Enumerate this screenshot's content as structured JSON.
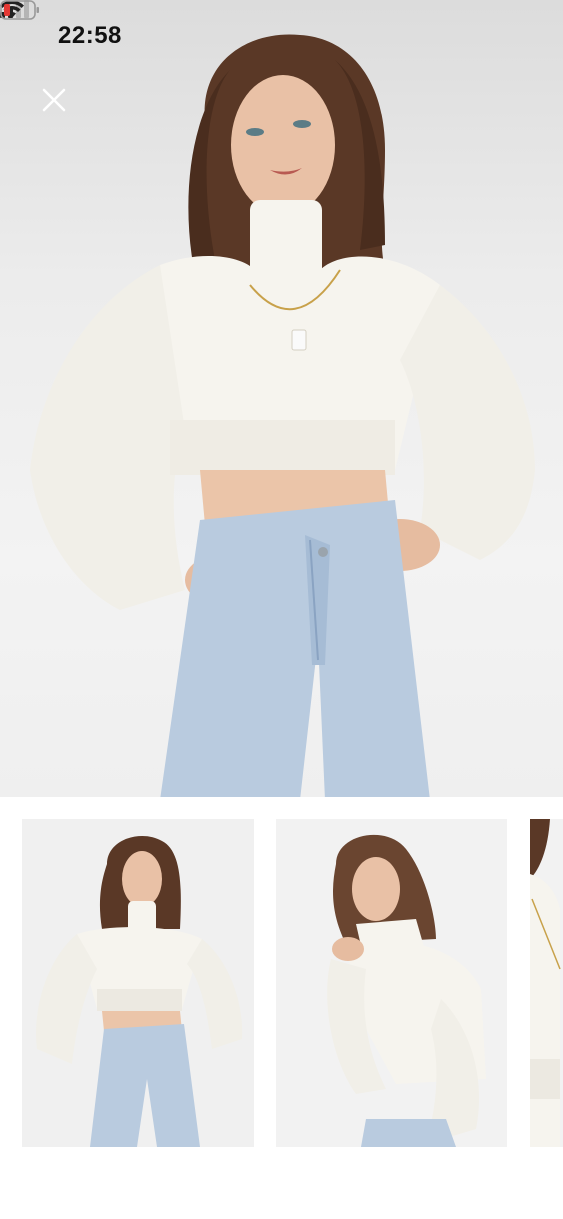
{
  "status_bar": {
    "time": "22:58",
    "icons": [
      "cellular-signal-icon",
      "wifi-icon",
      "battery-low-icon"
    ]
  },
  "header": {
    "close_icon": "close-icon"
  },
  "gallery": {
    "selected_index": 0,
    "thumbnails": [
      {
        "state": "selected"
      },
      {
        "state": "normal"
      },
      {
        "state": "normal"
      }
    ]
  },
  "colors": {
    "accent": "#e8913a",
    "battery_low": "#e53935",
    "sweater": "#f6f4ee",
    "denim": "#b9cbdf",
    "hair": "#5a3826"
  }
}
